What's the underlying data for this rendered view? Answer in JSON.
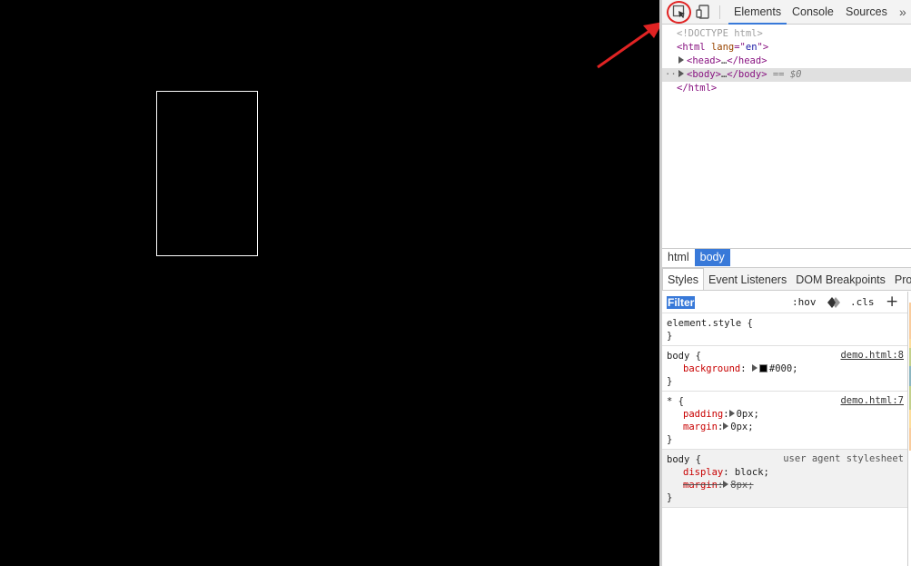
{
  "toolbar": {
    "tabs": [
      "Elements",
      "Console",
      "Sources"
    ],
    "more": "»"
  },
  "dom": {
    "doctype": "<!DOCTYPE html>",
    "html_open_tag": "<html",
    "html_attr_name": "lang",
    "html_attr_eq": "=\"",
    "html_attr_value": "en",
    "html_attr_close": "\">",
    "head_open": "<head>",
    "head_ellip": "…",
    "head_close": "</head>",
    "body_dots": "···",
    "body_open": "<body>",
    "body_ellip": "…",
    "body_close": "</body>",
    "selected_marker": "== $0",
    "html_close": "</html>"
  },
  "breadcrumbs": [
    "html",
    "body"
  ],
  "subtabs": [
    "Styles",
    "Event Listeners",
    "DOM Breakpoints",
    "Prope"
  ],
  "styles": {
    "filter": "Filter",
    "hov": ":hov",
    "cls": ".cls",
    "add": "+",
    "rules": [
      {
        "selector": "element.style {",
        "close": "}"
      },
      {
        "selector": "body {",
        "source": "demo.html:8",
        "decls": [
          {
            "prop": "background",
            "value": "#000;"
          }
        ],
        "close": "}"
      },
      {
        "selector": "* {",
        "source": "demo.html:7",
        "decls": [
          {
            "prop": "padding",
            "value": "0px;"
          },
          {
            "prop": "margin",
            "value": "0px;"
          }
        ],
        "close": "}"
      },
      {
        "selector": "body {",
        "source": "user agent stylesheet",
        "decls": [
          {
            "prop": "display",
            "value": "block;"
          },
          {
            "prop": "margin",
            "value": "8px;"
          }
        ],
        "close": "}"
      }
    ]
  },
  "colors": {
    "page_bg": "#000000",
    "accent": "#3879d9",
    "annotation": "#e02323"
  }
}
